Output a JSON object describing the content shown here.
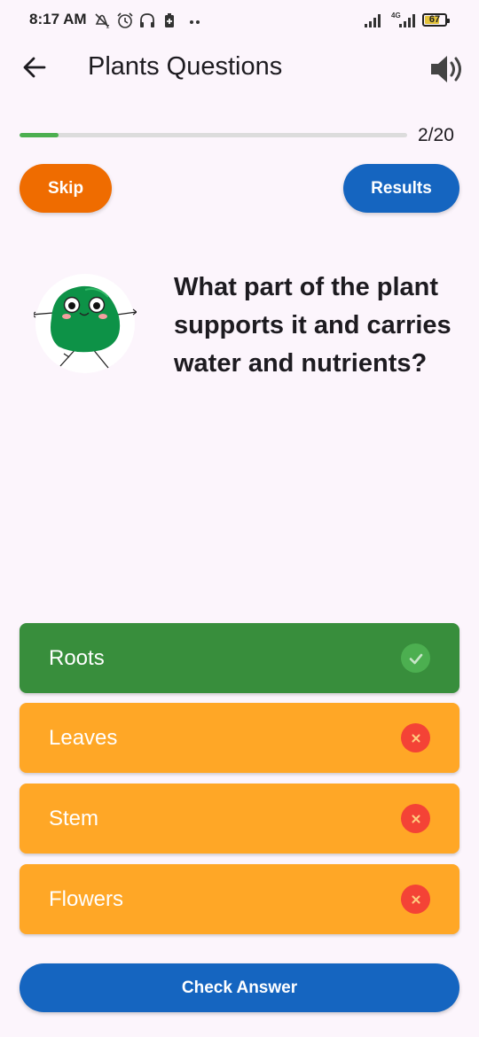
{
  "status_bar": {
    "time": "8:17 AM",
    "network_label": "4G",
    "battery": "67",
    "icons": [
      "no-disturb-icon",
      "alarm-icon",
      "headset-icon",
      "battery-saver-icon",
      "more-dots-icon",
      "signal-icon",
      "signal-4g-icon",
      "battery-icon"
    ]
  },
  "app_bar": {
    "title": "Plants Questions",
    "back_icon": "arrow-left-icon",
    "sound_icon": "speaker-volume-icon"
  },
  "progress": {
    "current": 2,
    "total": 20,
    "label": "2/20",
    "fraction": 0.1,
    "color": "#4caf50"
  },
  "actions": {
    "skip_label": "Skip",
    "results_label": "Results",
    "skip_color": "#ef6c00",
    "results_color": "#1565c0"
  },
  "question": {
    "text": "What part of the plant supports it and carries water and nutrients?",
    "mascot_icon": "green-blob-mascot-icon"
  },
  "answers": [
    {
      "label": "Roots",
      "state": "correct",
      "icon": "check-circle-icon"
    },
    {
      "label": "Leaves",
      "state": "wrong",
      "icon": "close-circle-icon"
    },
    {
      "label": "Stem",
      "state": "wrong",
      "icon": "close-circle-icon"
    },
    {
      "label": "Flowers",
      "state": "wrong",
      "icon": "close-circle-icon"
    }
  ],
  "colors": {
    "correct": "#388e3c",
    "wrong": "#ffa726",
    "wrong_mark": "#f44336",
    "correct_mark": "#4caf50",
    "primary": "#1565c0",
    "background": "#fcf5fc"
  },
  "check_answer_label": "Check Answer"
}
